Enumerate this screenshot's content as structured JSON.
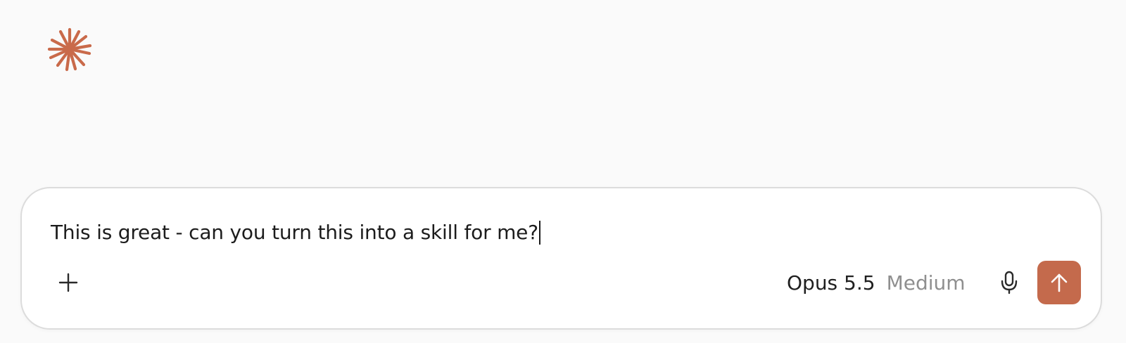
{
  "brand": {
    "logo_icon": "claude-starburst-icon",
    "accent_color": "#C96A4A"
  },
  "composer": {
    "input_value": "This is great - can you turn this into a skill for me?",
    "add_icon": "plus-icon",
    "model_name": "Opus 5.5",
    "effort_level": "Medium",
    "mic_icon": "microphone-icon",
    "send_icon": "arrow-up-icon",
    "send_color": "#C46A4C"
  }
}
